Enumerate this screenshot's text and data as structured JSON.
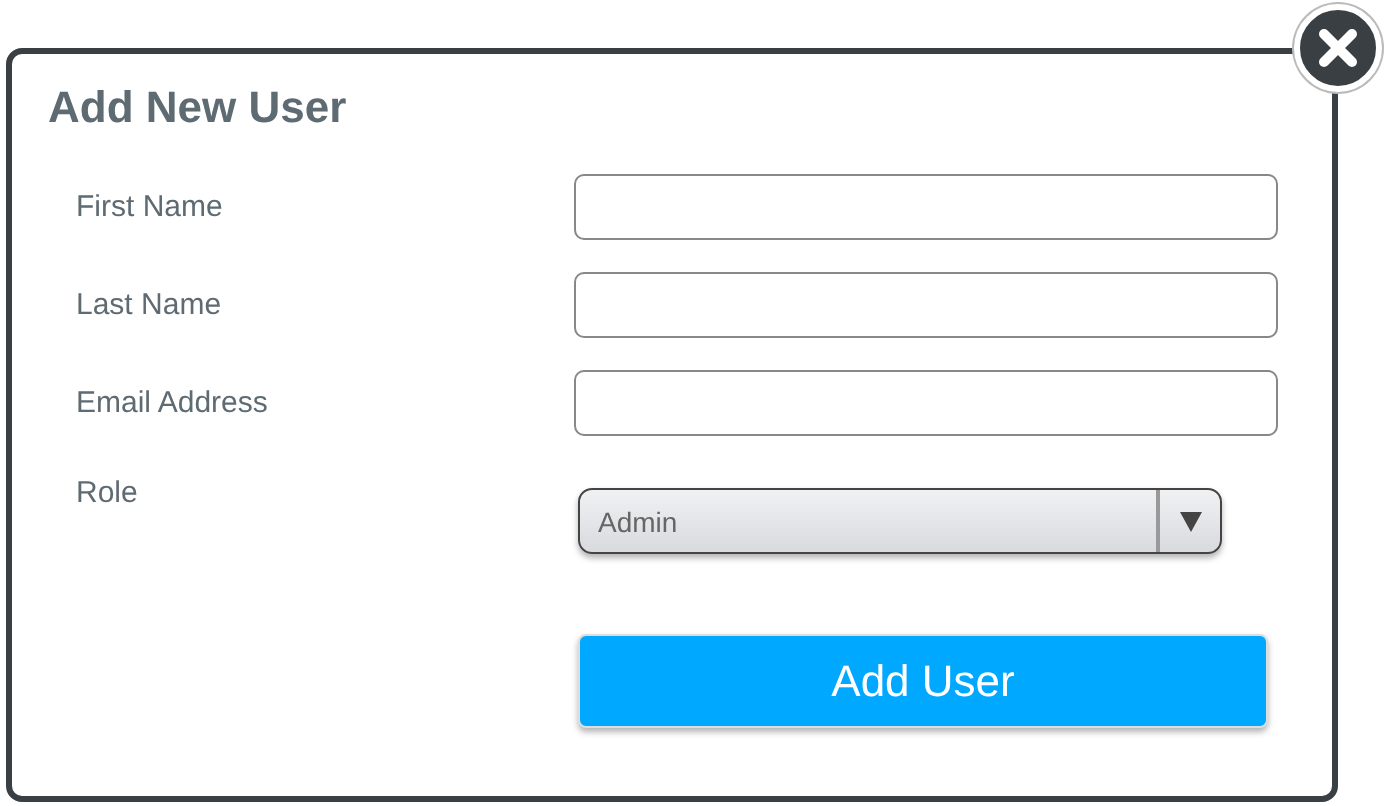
{
  "dialog": {
    "title": "Add New User"
  },
  "fields": [
    {
      "kind": "text",
      "label": "First Name"
    },
    {
      "kind": "text",
      "label": "Last Name"
    },
    {
      "kind": "text",
      "label": "Email Address"
    },
    {
      "kind": "select",
      "label": "Role",
      "value": "Admin"
    }
  ],
  "submit_button": "Add User"
}
